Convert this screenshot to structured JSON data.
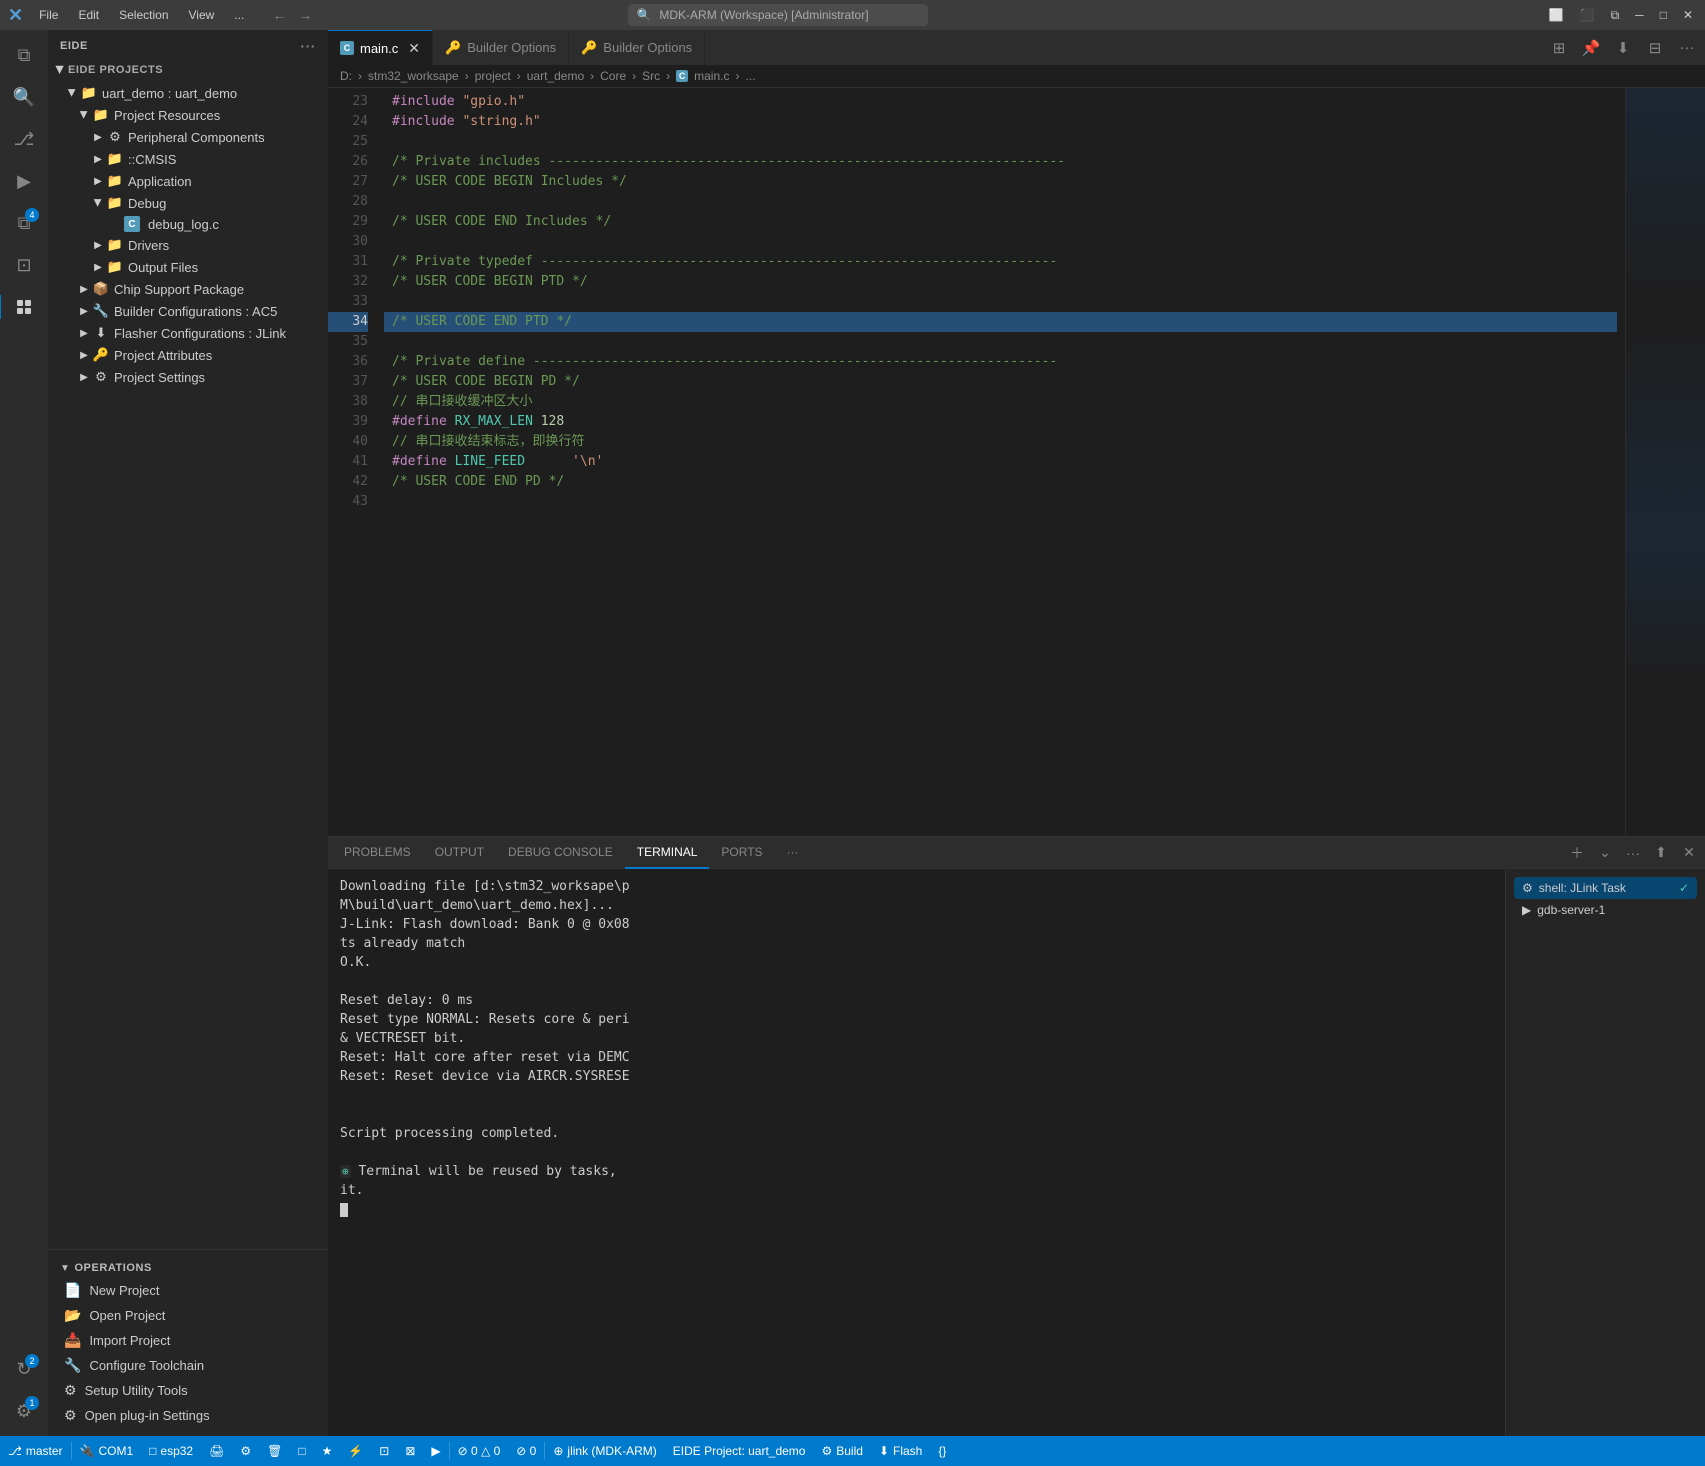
{
  "titleBar": {
    "logo": "X",
    "menus": [
      "File",
      "Edit",
      "Selection",
      "View",
      "..."
    ],
    "navBack": "←",
    "navForward": "→",
    "searchPlaceholder": "MDK-ARM (Workspace) [Administrator]",
    "windowControls": [
      "□",
      "─",
      "□",
      "✕"
    ]
  },
  "activityBar": {
    "icons": [
      {
        "name": "explorer-icon",
        "symbol": "⧉",
        "active": false
      },
      {
        "name": "search-icon",
        "symbol": "🔍",
        "active": false
      },
      {
        "name": "source-control-icon",
        "symbol": "⎇",
        "active": false
      },
      {
        "name": "debug-icon",
        "symbol": "▷",
        "active": false
      },
      {
        "name": "extensions-icon",
        "symbol": "⧉",
        "badge": "4",
        "active": false
      },
      {
        "name": "remote-icon",
        "symbol": "⊡",
        "active": false
      },
      {
        "name": "eide-icon",
        "symbol": "⚙",
        "active": true
      },
      {
        "name": "settings2-icon",
        "symbol": "⚙",
        "active": false
      },
      {
        "name": "account-icon",
        "symbol": "👤",
        "badge": "2",
        "active": false
      },
      {
        "name": "gear-icon",
        "symbol": "⚙",
        "badge": "1",
        "active": false
      }
    ]
  },
  "sidebar": {
    "header": "EIDE",
    "projectsLabel": "EIDE PROJECTS",
    "projectName": "uart_demo : uart_demo",
    "treeItems": [
      {
        "id": "project-resources",
        "label": "Project Resources",
        "level": 2,
        "expanded": true,
        "icon": "📁"
      },
      {
        "id": "peripheral-components",
        "label": "Peripheral Components",
        "level": 3,
        "expanded": false,
        "icon": "⚙"
      },
      {
        "id": "cmsis",
        "label": "::CMSIS",
        "level": 3,
        "expanded": false,
        "icon": "📁"
      },
      {
        "id": "application",
        "label": "Application",
        "level": 3,
        "expanded": false,
        "icon": "📁"
      },
      {
        "id": "debug",
        "label": "Debug",
        "level": 3,
        "expanded": true,
        "icon": "📁"
      },
      {
        "id": "debug-log-c",
        "label": "debug_log.c",
        "level": 4,
        "expanded": false,
        "icon": "C",
        "fileType": "c"
      },
      {
        "id": "drivers",
        "label": "Drivers",
        "level": 3,
        "expanded": false,
        "icon": "📁"
      },
      {
        "id": "output-files",
        "label": "Output Files",
        "level": 3,
        "expanded": false,
        "icon": "📁"
      },
      {
        "id": "chip-support-package",
        "label": "Chip Support Package",
        "level": 2,
        "expanded": false,
        "icon": "📦"
      },
      {
        "id": "builder-configurations",
        "label": "Builder Configurations : AC5",
        "level": 2,
        "expanded": false,
        "icon": "🔧"
      },
      {
        "id": "flasher-configurations",
        "label": "Flasher Configurations : JLink",
        "level": 2,
        "expanded": false,
        "icon": "⬇"
      },
      {
        "id": "project-attributes",
        "label": "Project Attributes",
        "level": 2,
        "expanded": false,
        "icon": "🔑"
      },
      {
        "id": "project-settings",
        "label": "Project Settings",
        "level": 2,
        "expanded": false,
        "icon": "⚙"
      }
    ],
    "operations": {
      "label": "OPERATIONS",
      "items": [
        {
          "id": "new-project",
          "label": "New Project",
          "icon": "📄"
        },
        {
          "id": "open-project",
          "label": "Open Project",
          "icon": "📂"
        },
        {
          "id": "import-project",
          "label": "Import Project",
          "icon": "📥"
        },
        {
          "id": "configure-toolchain",
          "label": "Configure Toolchain",
          "icon": "🔧"
        },
        {
          "id": "setup-utility-tools",
          "label": "Setup Utility Tools",
          "icon": "⚙"
        },
        {
          "id": "open-plugin-settings",
          "label": "Open plug-in Settings",
          "icon": "⚙"
        }
      ]
    }
  },
  "editor": {
    "tabs": [
      {
        "id": "main-c",
        "label": "main.c",
        "active": true,
        "icon": "C"
      },
      {
        "id": "builder-options-1",
        "label": "Builder Options",
        "active": false,
        "icon": "🔑"
      },
      {
        "id": "builder-options-2",
        "label": "Builder Options",
        "active": false,
        "icon": "🔑"
      }
    ],
    "breadcrumb": [
      "D:",
      "stm32_worksape",
      "project",
      "uart_demo",
      "Core",
      "Src",
      "C  main.c",
      "..."
    ],
    "lines": [
      {
        "num": 23,
        "content": "#include \"gpio.h\"",
        "tokens": [
          {
            "text": "#include ",
            "cls": "kw-include"
          },
          {
            "text": "\"gpio.h\"",
            "cls": "kw-string"
          }
        ]
      },
      {
        "num": 24,
        "content": "#include \"string.h\"",
        "tokens": [
          {
            "text": "#include ",
            "cls": "kw-include"
          },
          {
            "text": "\"string.h\"",
            "cls": "kw-string"
          }
        ]
      },
      {
        "num": 25,
        "content": ""
      },
      {
        "num": 26,
        "content": "/* Private includes ---------------",
        "tokens": [
          {
            "text": "/* Private includes ---------------",
            "cls": "kw-comment"
          }
        ]
      },
      {
        "num": 27,
        "content": "/* USER CODE BEGIN Includes */",
        "tokens": [
          {
            "text": "/* USER CODE BEGIN Includes */",
            "cls": "kw-comment"
          }
        ]
      },
      {
        "num": 28,
        "content": ""
      },
      {
        "num": 29,
        "content": "/* USER CODE END Includes */",
        "tokens": [
          {
            "text": "/* USER CODE END Includes */",
            "cls": "kw-comment"
          }
        ]
      },
      {
        "num": 30,
        "content": ""
      },
      {
        "num": 31,
        "content": "/* Private typedef ---------------",
        "tokens": [
          {
            "text": "/* Private typedef ---------------",
            "cls": "kw-comment"
          }
        ]
      },
      {
        "num": 32,
        "content": "/* USER CODE BEGIN PTD */",
        "tokens": [
          {
            "text": "/* USER CODE BEGIN PTD */",
            "cls": "kw-comment"
          }
        ]
      },
      {
        "num": 33,
        "content": ""
      },
      {
        "num": 34,
        "content": "/* USER CODE END PTD */",
        "tokens": [
          {
            "text": "/* USER CODE END PTD */",
            "cls": "kw-comment"
          }
        ],
        "highlighted": true
      },
      {
        "num": 35,
        "content": ""
      },
      {
        "num": 36,
        "content": "/* Private define ----------------",
        "tokens": [
          {
            "text": "/* Private define ----------------",
            "cls": "kw-comment"
          }
        ]
      },
      {
        "num": 37,
        "content": "/* USER CODE BEGIN PD */",
        "tokens": [
          {
            "text": "/* USER CODE BEGIN PD */",
            "cls": "kw-comment"
          }
        ]
      },
      {
        "num": 38,
        "content": "// 串口接收缓冲区大小",
        "tokens": [
          {
            "text": "// 串口接收缓冲区大小",
            "cls": "kw-comment"
          }
        ]
      },
      {
        "num": 39,
        "content": "#define RX_MAX_LEN 128",
        "tokens": [
          {
            "text": "#define ",
            "cls": "kw-define"
          },
          {
            "text": "RX_MAX_LEN",
            "cls": "kw-macro"
          },
          {
            "text": " 128",
            "cls": "kw-number"
          }
        ]
      },
      {
        "num": 40,
        "content": "// 串口接收结束标志，即换行符",
        "tokens": [
          {
            "text": "// 串口接收结束标志，即换行符",
            "cls": "kw-comment"
          }
        ]
      },
      {
        "num": 41,
        "content": "#define LINE_FEED      '\\n'",
        "tokens": [
          {
            "text": "#define ",
            "cls": "kw-define"
          },
          {
            "text": "LINE_FEED",
            "cls": "kw-macro"
          },
          {
            "text": "      ",
            "cls": ""
          },
          {
            "text": "'\\n'",
            "cls": "kw-char"
          }
        ]
      },
      {
        "num": 42,
        "content": "/* USER CODE END PD */",
        "tokens": [
          {
            "text": "/* USER CODE END PD */",
            "cls": "kw-comment"
          }
        ]
      },
      {
        "num": 43,
        "content": ""
      }
    ]
  },
  "terminal": {
    "tabs": [
      "PROBLEMS",
      "OUTPUT",
      "DEBUG CONSOLE",
      "TERMINAL",
      "PORTS",
      "..."
    ],
    "activeTab": "TERMINAL",
    "content": [
      "Downloading file [d:\\stm32_worksape\\p",
      "M\\build\\uart_demo\\uart_demo.hex]...",
      "J-Link: Flash download: Bank 0 @ 0x08",
      "ts already match",
      "O.K.",
      "",
      "Reset delay: 0 ms",
      "Reset type NORMAL: Resets core & peri",
      " & VECTRESET bit.",
      "Reset: Halt core after reset via DEMC",
      "Reset: Reset device via AIRCR.SYSRESE",
      "",
      "",
      "Script processing completed.",
      "",
      "⊕  Terminal will be reused by tasks,",
      " it.",
      "█"
    ],
    "sessions": [
      {
        "label": "shell: JLink  Task",
        "icon": "⚙",
        "active": true,
        "checkmark": true
      },
      {
        "label": "gdb-server-1",
        "icon": "▷",
        "active": false
      }
    ]
  },
  "statusBar": {
    "items": [
      {
        "id": "git-branch",
        "label": "⎇ master",
        "left": true
      },
      {
        "id": "com-port",
        "label": "🔌 COM1"
      },
      {
        "id": "board",
        "label": "□ esp32"
      },
      {
        "id": "printer-icon",
        "label": "🖨"
      },
      {
        "id": "settings-icon",
        "label": "⚙"
      },
      {
        "id": "trash-icon",
        "label": "🗑"
      },
      {
        "id": "build-icon",
        "label": "□"
      },
      {
        "id": "star-icon",
        "label": "★"
      },
      {
        "id": "flash-icon",
        "label": "⚡"
      },
      {
        "id": "terminal-icon",
        "label": "⊡"
      },
      {
        "id": "monitor-icon",
        "label": "⊠"
      },
      {
        "id": "serial-icon",
        "label": "▷"
      },
      {
        "id": "errors",
        "label": "⊘ 0 △ 0"
      },
      {
        "id": "warnings",
        "label": "⊘ 0"
      },
      {
        "id": "jlink",
        "label": "⊕ jlink (MDK-ARM)"
      },
      {
        "id": "eide-project",
        "label": "EIDE Project: uart_demo"
      },
      {
        "id": "build-label",
        "label": "⚙ Build"
      },
      {
        "id": "flash-label",
        "label": "⬇ Flash"
      },
      {
        "id": "braces",
        "label": "{}"
      }
    ]
  }
}
